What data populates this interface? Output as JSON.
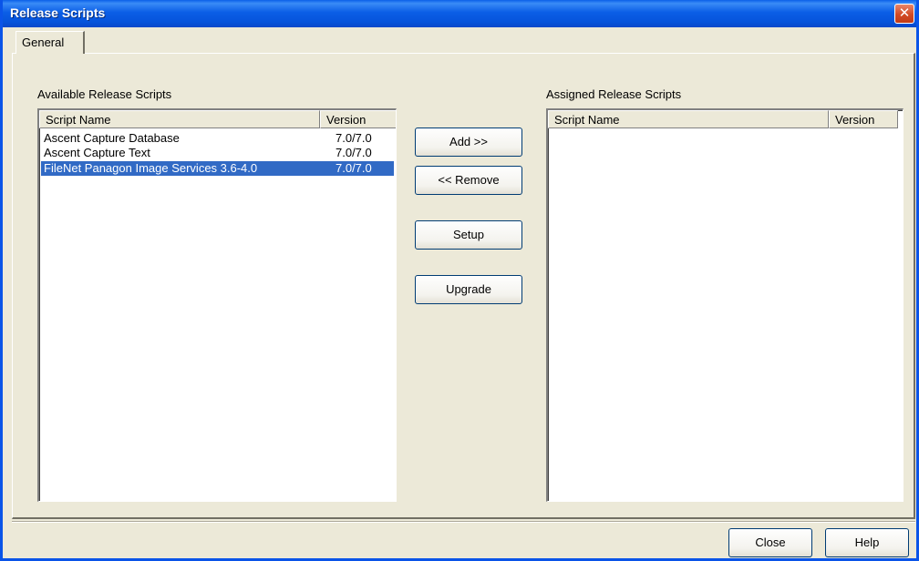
{
  "window": {
    "title": "Release Scripts",
    "close_glyph": "✕"
  },
  "tabs": [
    {
      "label": "General",
      "selected": true
    }
  ],
  "available": {
    "label": "Available Release Scripts",
    "columns": [
      "Script Name",
      "Version"
    ],
    "rows": [
      {
        "name": "Ascent Capture Database",
        "version": "7.0/7.0",
        "selected": false
      },
      {
        "name": "Ascent Capture Text",
        "version": "7.0/7.0",
        "selected": false
      },
      {
        "name": "FileNet Panagon Image Services 3.6-4.0",
        "version": "7.0/7.0",
        "selected": true
      }
    ]
  },
  "assigned": {
    "label": "Assigned Release Scripts",
    "columns": [
      "Script Name",
      "Version"
    ],
    "rows": []
  },
  "actions": {
    "add": "Add >>",
    "remove": "<< Remove",
    "setup": "Setup",
    "upgrade": "Upgrade"
  },
  "footer": {
    "close": "Close",
    "help": "Help"
  },
  "colors": {
    "titlebar": "#0a5fe8",
    "selection": "#316ac5",
    "dialog_bg": "#ece9d8"
  }
}
